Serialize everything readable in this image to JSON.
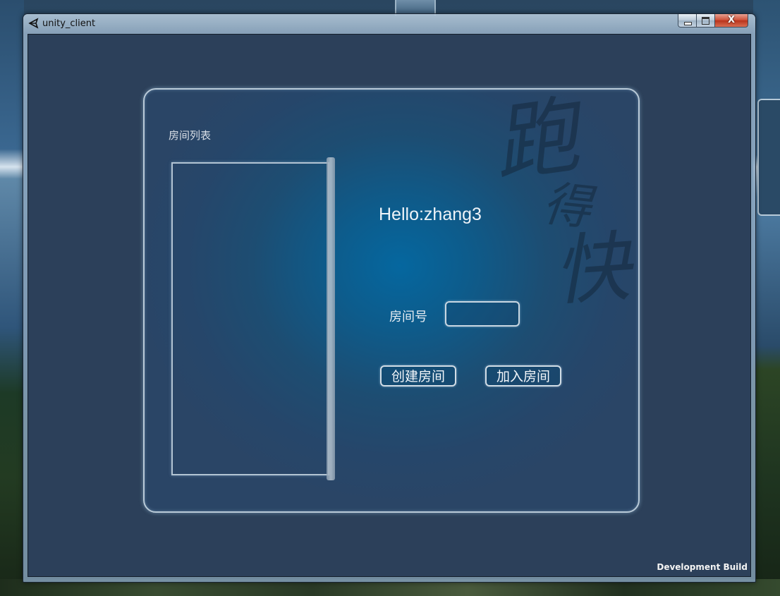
{
  "window": {
    "title": "unity_client",
    "icon": "unity-logo-icon",
    "controls": {
      "minimize": "minimize-icon",
      "maximize": "maximize-icon",
      "close": "close-icon",
      "close_glyph": "X"
    }
  },
  "lobby": {
    "room_list_label": "房间列表",
    "greeting": "Hello:zhang3",
    "room_number_label": "房间号",
    "room_number_value": "",
    "create_room_label": "创建房间",
    "join_room_label": "加入房间"
  },
  "footer": {
    "build_label": "Development Build"
  },
  "colors": {
    "panel_center": "#05679f",
    "panel_edge": "#2a4566",
    "client_bg": "#2c405a",
    "outline": "#c9d7e2"
  }
}
